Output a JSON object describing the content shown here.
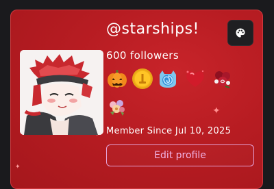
{
  "profile": {
    "username": "@starships!",
    "followers": "600 followers",
    "member_since": "Member Since Jul 10, 2025",
    "edit_label": "Edit profile"
  },
  "icons": {
    "theme": "palette-icon"
  },
  "badges": [
    {
      "name": "pumpkin-badge"
    },
    {
      "name": "gold-coin-badge"
    },
    {
      "name": "blue-swirl-badge"
    },
    {
      "name": "red-heart-badge"
    },
    {
      "name": "rose-bouquet-badge"
    },
    {
      "name": "flower-bundle-badge"
    }
  ],
  "colors": {
    "card_background": "#b71c22",
    "edit_button_border": "#e4a2d7",
    "page_background": "#1a1a1d"
  }
}
